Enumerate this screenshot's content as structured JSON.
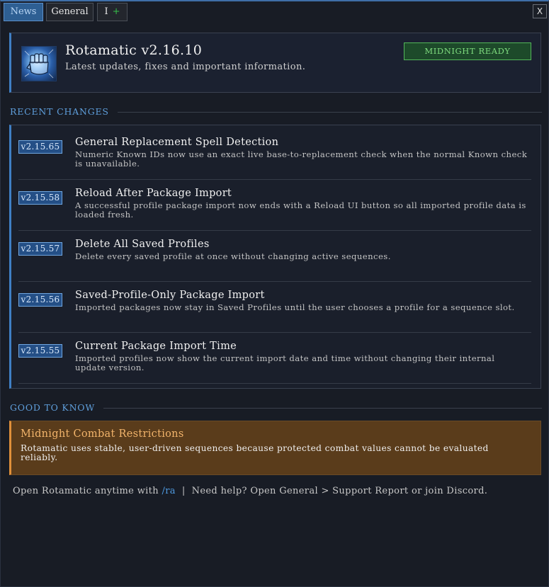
{
  "tabs": [
    {
      "label": "News",
      "active": true
    },
    {
      "label": "General",
      "active": false
    },
    {
      "label": "I",
      "plus": "+",
      "active": false
    }
  ],
  "close_label": "X",
  "header": {
    "icon": "fist-icon",
    "title": "Rotamatic v2.16.10",
    "subtitle": "Latest updates, fixes and important information.",
    "badge": "MIDNIGHT READY"
  },
  "recent_changes": {
    "heading": "RECENT CHANGES",
    "items": [
      {
        "version": "v2.15.65",
        "title": "General Replacement Spell Detection",
        "desc": "Numeric Known IDs now use an exact live base-to-replacement check when the normal Known check is unavailable."
      },
      {
        "version": "v2.15.58",
        "title": "Reload After Package Import",
        "desc": "A successful profile package import now ends with a Reload UI button so all imported profile data is loaded fresh."
      },
      {
        "version": "v2.15.57",
        "title": "Delete All Saved Profiles",
        "desc": "Delete every saved profile at once without changing active sequences."
      },
      {
        "version": "v2.15.56",
        "title": "Saved-Profile-Only Package Import",
        "desc": "Imported packages now stay in Saved Profiles until the user chooses a profile for a sequence slot."
      },
      {
        "version": "v2.15.55",
        "title": "Current Package Import Time",
        "desc": "Imported profiles now show the current import date and time without changing their internal update version."
      }
    ]
  },
  "good_to_know": {
    "heading": "GOOD TO KNOW",
    "title": "Midnight Combat Restrictions",
    "text": "Rotamatic uses stable, user-driven sequences because protected combat values cannot be evaluated reliably."
  },
  "footer": {
    "prefix": "Open Rotamatic anytime with",
    "command": "/ra",
    "separator": "|",
    "help": "Need help? Open General > Support Report or join Discord."
  },
  "colors": {
    "accent": "#3f7fc4",
    "badge_green": "#53b75a",
    "warning": "#e0903a"
  }
}
